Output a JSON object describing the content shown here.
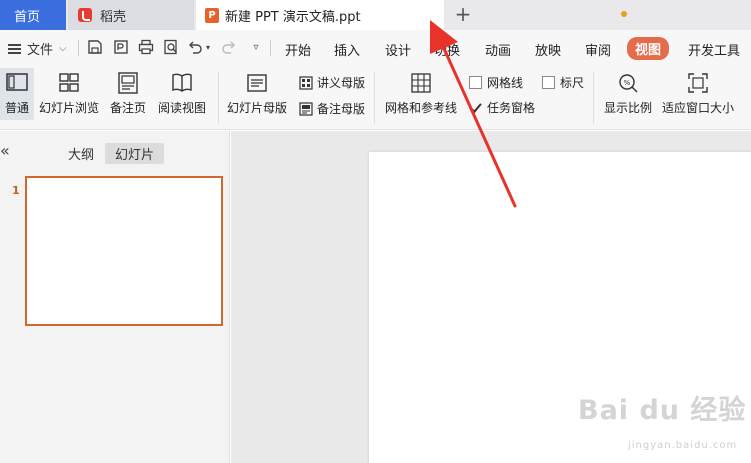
{
  "tabs": {
    "home": "首页",
    "daoke": "稻壳",
    "doc": "新建 PPT 演示文稿.ppt",
    "new_tab": "+"
  },
  "quick": {
    "file": "文件"
  },
  "menu": [
    {
      "label": "开始"
    },
    {
      "label": "插入"
    },
    {
      "label": "设计"
    },
    {
      "label": "切换"
    },
    {
      "label": "动画"
    },
    {
      "label": "放映"
    },
    {
      "label": "审阅"
    },
    {
      "label": "视图"
    },
    {
      "label": "开发工具"
    }
  ],
  "ribbon": {
    "normal": "普通",
    "slide_sorter": "幻灯片浏览",
    "notes_page": "备注页",
    "reading_view": "阅读视图",
    "slide_master": "幻灯片母版",
    "handout_master": "讲义母版",
    "notes_master": "备注母版",
    "grid_guides": "网格和参考线",
    "gridlines": "网格线",
    "ruler": "标尺",
    "task_pane": "任务窗格",
    "zoom": "显示比例",
    "fit_window": "适应窗口大小"
  },
  "checks": {
    "gridlines": false,
    "ruler": false,
    "task_pane": true
  },
  "panel": {
    "collapse": "«",
    "outline": "大纲",
    "slides": "幻灯片",
    "slide_number": "1"
  },
  "watermark": {
    "brand": "Bai du 经验",
    "url": "jingyan.baidu.com"
  },
  "colors": {
    "accent": "#e56c4b",
    "home_tab": "#3b6fe0",
    "annotation": "#e8322a"
  }
}
